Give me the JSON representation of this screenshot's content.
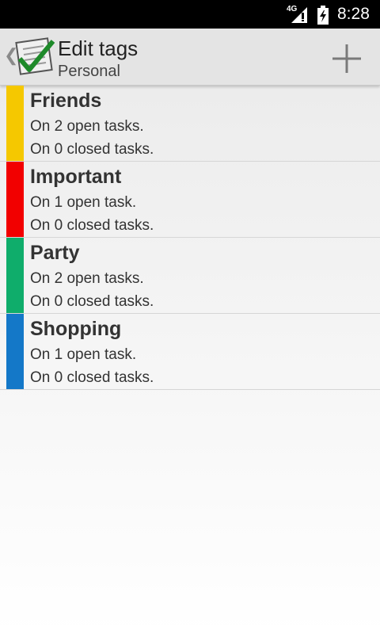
{
  "status_bar": {
    "network_label": "4G",
    "time": "8:28",
    "icons": [
      "signal-icon",
      "battery-icon"
    ]
  },
  "action_bar": {
    "title": "Edit tags",
    "subtitle": "Personal",
    "up_icon": "chevron-left-icon",
    "app_icon": "checklist-icon",
    "add_icon": "plus-icon"
  },
  "tags": [
    {
      "name": "Friends",
      "open": "On 2 open tasks.",
      "closed": "On 0 closed tasks.",
      "color": "#f5c800"
    },
    {
      "name": "Important",
      "open": "On 1 open task.",
      "closed": "On 0 closed tasks.",
      "color": "#f20000"
    },
    {
      "name": "Party",
      "open": "On 2 open tasks.",
      "closed": "On 0 closed tasks.",
      "color": "#0fad6b"
    },
    {
      "name": "Shopping",
      "open": "On 1 open task.",
      "closed": "On 0 closed tasks.",
      "color": "#1478c8"
    }
  ]
}
